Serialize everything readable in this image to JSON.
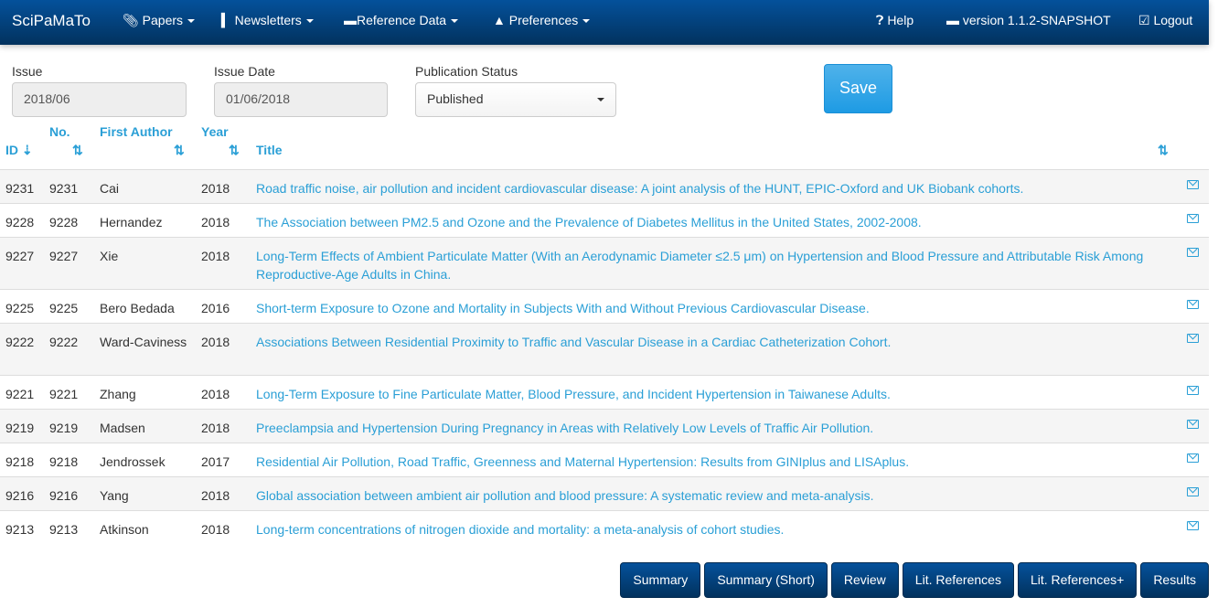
{
  "navbar": {
    "brand": "SciPaMaTo",
    "items": [
      {
        "label": "Papers",
        "icon": "paperclip-icon"
      },
      {
        "label": "Newsletters",
        "icon": "book-icon"
      },
      {
        "label": "Reference Data",
        "icon": "folder-open-icon"
      },
      {
        "label": "Preferences",
        "icon": "user-icon"
      }
    ],
    "help": "Help",
    "version": "version 1.1.2-SNAPSHOT",
    "logout": "Logout"
  },
  "form": {
    "issue_label": "Issue",
    "issue_value": "2018/06",
    "date_label": "Issue Date",
    "date_value": "01/06/2018",
    "status_label": "Publication Status",
    "status_value": "Published",
    "save": "Save"
  },
  "table": {
    "headers": {
      "id": "ID",
      "no": "No.",
      "author": "First Author",
      "year": "Year",
      "title": "Title"
    },
    "rows": [
      {
        "id": "9231",
        "no": "9231",
        "author": "Cai",
        "year": "2018",
        "title": "Road traffic noise, air pollution and incident cardiovascular disease: A joint analysis of the HUNT, EPIC-Oxford and UK Biobank cohorts."
      },
      {
        "id": "9228",
        "no": "9228",
        "author": "Hernandez",
        "year": "2018",
        "title": "The Association between PM2.5 and Ozone and the Prevalence of Diabetes Mellitus in the United States, 2002-2008."
      },
      {
        "id": "9227",
        "no": "9227",
        "author": "Xie",
        "year": "2018",
        "title": "Long-Term Effects of Ambient Particulate Matter (With an Aerodynamic Diameter ≤2.5 μm) on Hypertension and Blood Pressure and Attributable Risk Among Reproductive-Age Adults in China."
      },
      {
        "id": "9225",
        "no": "9225",
        "author": "Bero Bedada",
        "year": "2016",
        "title": "Short-term Exposure to Ozone and Mortality in Subjects With and Without Previous Cardiovascular Disease."
      },
      {
        "id": "9222",
        "no": "9222",
        "author": "Ward-Caviness",
        "year": "2018",
        "title": "Associations Between Residential Proximity to Traffic and Vascular Disease in a Cardiac Catheterization Cohort."
      },
      {
        "id": "9221",
        "no": "9221",
        "author": "Zhang",
        "year": "2018",
        "title": "Long-Term Exposure to Fine Particulate Matter, Blood Pressure, and Incident Hypertension in Taiwanese Adults."
      },
      {
        "id": "9219",
        "no": "9219",
        "author": "Madsen",
        "year": "2018",
        "title": "Preeclampsia and Hypertension During Pregnancy in Areas with Relatively Low Levels of Traffic Air Pollution."
      },
      {
        "id": "9218",
        "no": "9218",
        "author": "Jendrossek",
        "year": "2017",
        "title": "Residential Air Pollution, Road Traffic, Greenness and Maternal Hypertension: Results from GINIplus and LISAplus."
      },
      {
        "id": "9216",
        "no": "9216",
        "author": "Yang",
        "year": "2018",
        "title": "Global association between ambient air pollution and blood pressure: A systematic review and meta-analysis."
      },
      {
        "id": "9213",
        "no": "9213",
        "author": "Atkinson",
        "year": "2018",
        "title": "Long-term concentrations of nitrogen dioxide and mortality: a meta-analysis of cohort studies."
      }
    ]
  },
  "buttons": [
    "Summary",
    "Summary (Short)",
    "Review",
    "Lit. References",
    "Lit. References+",
    "Results"
  ]
}
